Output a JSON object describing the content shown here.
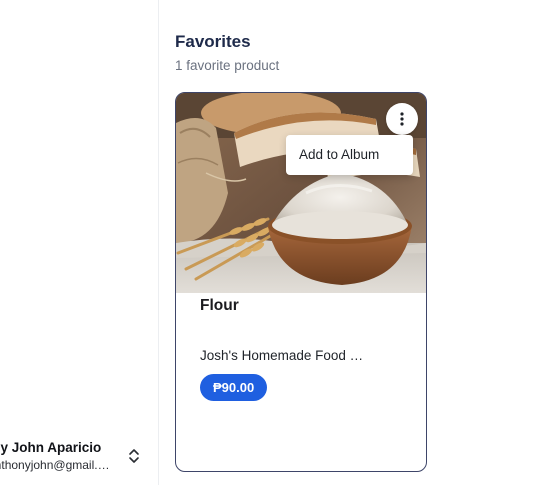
{
  "sidebar": {
    "user": {
      "name": "ony John Aparicio",
      "email": "o.anthonyjohn@gmail.com",
      "switch_icon": "chevron-up-down-icon"
    }
  },
  "main": {
    "title": "Favorites",
    "subtitle": "1 favorite product",
    "products": [
      {
        "name": "Flour",
        "seller": "Josh's Homemade Food Products",
        "price": "₱90.00",
        "image": "flour-bowl-with-bread-photo",
        "menu_icon": "more-vertical-icon",
        "menu": {
          "open": true,
          "items": [
            "Add to Album"
          ]
        }
      }
    ]
  },
  "colors": {
    "title": "#1e2a4a",
    "subtitle": "#6b7280",
    "card_border": "#3e4569",
    "price_badge": "#1f5fe0",
    "divider": "#eceef1"
  }
}
